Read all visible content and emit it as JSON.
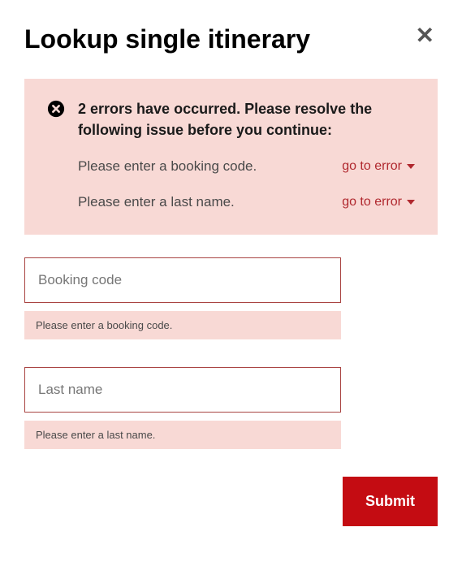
{
  "header": {
    "title": "Lookup single itinerary",
    "close_label": "✕"
  },
  "error_panel": {
    "title": "2 errors have occurred. Please resolve the following issue before you continue:",
    "items": [
      {
        "text": "Please enter a booking code.",
        "goto_label": "go to error"
      },
      {
        "text": "Please enter a last name.",
        "goto_label": "go to error"
      }
    ]
  },
  "fields": {
    "booking_code": {
      "placeholder": "Booking code",
      "value": "",
      "error": "Please enter a booking code."
    },
    "last_name": {
      "placeholder": "Last name",
      "value": "",
      "error": "Please enter a last name."
    }
  },
  "actions": {
    "submit_label": "Submit"
  }
}
